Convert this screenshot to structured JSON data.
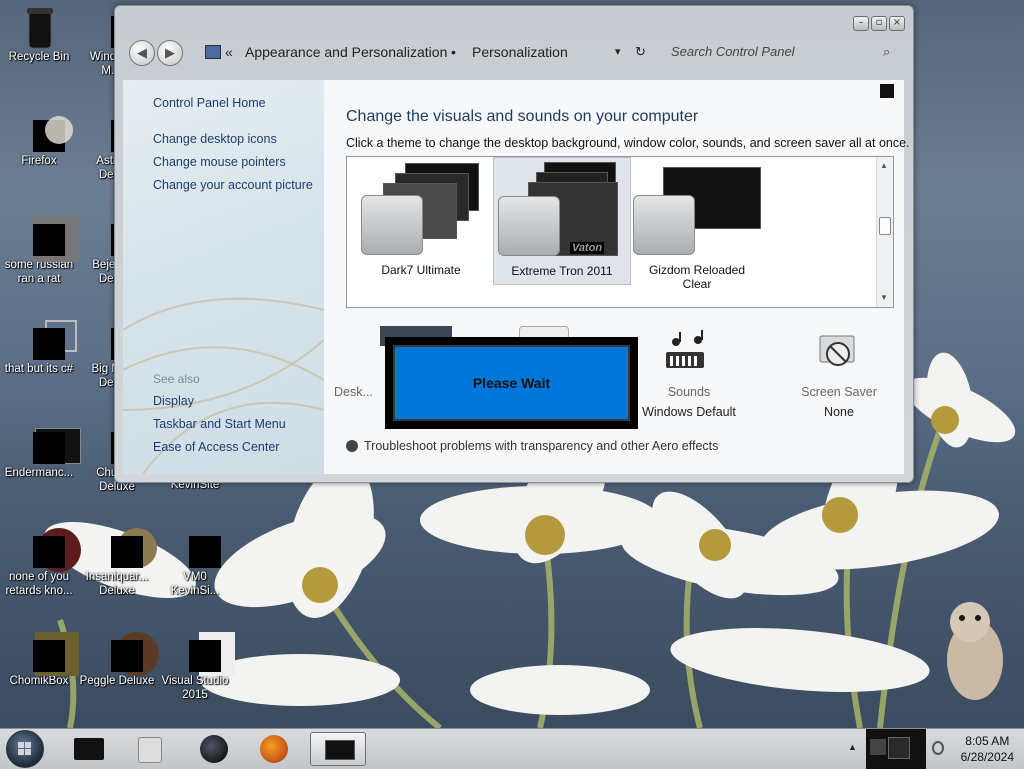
{
  "desktop": {
    "icons": [
      {
        "label": "Recycle Bin"
      },
      {
        "label": "Windo...\nM..."
      },
      {
        "label": "Firefox"
      },
      {
        "label": "Astr...\nDe..."
      },
      {
        "label": "some russian\nran a rat"
      },
      {
        "label": "Bejev...\nDe..."
      },
      {
        "label": "that but its c#"
      },
      {
        "label": "Big M...\nDe..."
      },
      {
        "label": "Endermanc..."
      },
      {
        "label": "Chuzzle\nDeluxe"
      },
      {
        "label": "VMbot\nKevinSite"
      },
      {
        "label": "none of you\nretards kno..."
      },
      {
        "label": "Insaniquar...\nDeluxe"
      },
      {
        "label": "VM0\nKevinSi..."
      },
      {
        "label": "ChomikBox"
      },
      {
        "label": "Peggle Deluxe"
      },
      {
        "label": "Visual Studio\n2015"
      }
    ]
  },
  "window": {
    "caption": {
      "minimize": "–",
      "maximize": "▫",
      "close": "×"
    },
    "address": {
      "chevron": "«",
      "crumb1": "Appearance and Personalization",
      "sep": "•",
      "crumb2": "Personalization",
      "dropdown": "▾",
      "refresh": "↻"
    },
    "search": {
      "placeholder": "Search Control Panel",
      "icon": "⌕"
    },
    "sidebar": {
      "home": "Control Panel Home",
      "links": [
        "Change desktop icons",
        "Change mouse pointers",
        "Change your account picture"
      ],
      "see_also_header": "See also",
      "see_also": [
        "Display",
        "Taskbar and Start Menu",
        "Ease of Access Center"
      ]
    },
    "main": {
      "title": "Change the visuals and sounds on your computer",
      "subtitle": "Click a theme to change the desktop background, window color, sounds, and screen saver all at once.",
      "themes": [
        {
          "name": "Dark7 Ultimate"
        },
        {
          "name": "Extreme Tron 2011",
          "badge": "Vaton"
        },
        {
          "name": "Gizdom Reloaded\nClear"
        }
      ],
      "bottom": {
        "desktop_label": "Desk...",
        "sounds_label": "Sounds",
        "sounds_value": "Windows Default",
        "screensaver_label": "Screen Saver",
        "screensaver_value": "None"
      },
      "troubleshoot": "Troubleshoot problems with transparency and other Aero effects"
    }
  },
  "dialog": {
    "message": "Please Wait"
  },
  "taskbar": {
    "clock_time": "8:05 AM",
    "clock_date": "6/28/2024",
    "tray_arrow": "▲"
  }
}
